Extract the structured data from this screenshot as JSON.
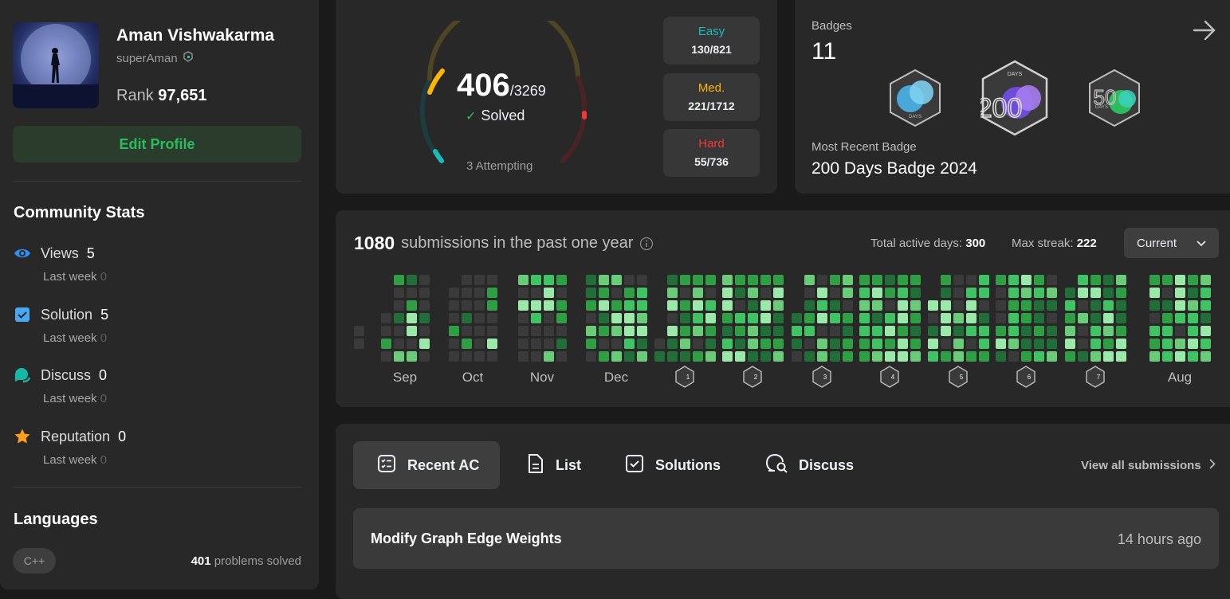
{
  "profile": {
    "name": "Aman Vishwakarma",
    "handle": "superAman",
    "rank_label": "Rank",
    "rank": "97,651",
    "edit_label": "Edit Profile"
  },
  "community": {
    "title": "Community Stats",
    "items": [
      {
        "label": "Views",
        "value": "5",
        "sub_label": "Last week",
        "sub_value": "0",
        "icon": "eye-icon",
        "color": "#2f8ef0"
      },
      {
        "label": "Solution",
        "value": "5",
        "sub_label": "Last week",
        "sub_value": "0",
        "icon": "checkbox-icon",
        "color": "#4aa8f0"
      },
      {
        "label": "Discuss",
        "value": "0",
        "sub_label": "Last week",
        "sub_value": "0",
        "icon": "discuss-icon",
        "color": "#15b8a6"
      },
      {
        "label": "Reputation",
        "value": "0",
        "sub_label": "Last week",
        "sub_value": "0",
        "icon": "star-icon",
        "color": "#ffa116"
      }
    ]
  },
  "languages": {
    "title": "Languages",
    "items": [
      {
        "name": "C++",
        "count": "401",
        "suffix": "problems solved"
      }
    ]
  },
  "solved": {
    "count": "406",
    "total": "/3269",
    "label": "Solved",
    "attempting": "3 Attempting",
    "difficulties": [
      {
        "label": "Easy",
        "value": "130/821",
        "color": "#1cbaba"
      },
      {
        "label": "Med.",
        "value": "221/1712",
        "color": "#ffb700"
      },
      {
        "label": "Hard",
        "value": "55/736",
        "color": "#f63737"
      }
    ]
  },
  "badges": {
    "title": "Badges",
    "count": "11",
    "recent_label": "Most Recent Badge",
    "recent": "200 Days Badge 2024",
    "badge_text": "DAYS",
    "badge_num_200": "200",
    "badge_num_50": "50"
  },
  "submissions": {
    "count": "1080",
    "text": "submissions in the past one year",
    "active_label": "Total active days:",
    "active_value": "300",
    "streak_label": "Max streak:",
    "streak_value": "222",
    "dropdown": "Current",
    "months": [
      "Sep",
      "Oct",
      "Nov",
      "Dec",
      "1",
      "2",
      "3",
      "4",
      "5",
      "6",
      "7",
      "Aug"
    ]
  },
  "recent": {
    "tabs": [
      "Recent AC",
      "List",
      "Solutions",
      "Discuss"
    ],
    "view_all": "View all submissions",
    "items": [
      {
        "title": "Modify Graph Edge Weights",
        "time": "14 hours ago"
      }
    ]
  }
}
